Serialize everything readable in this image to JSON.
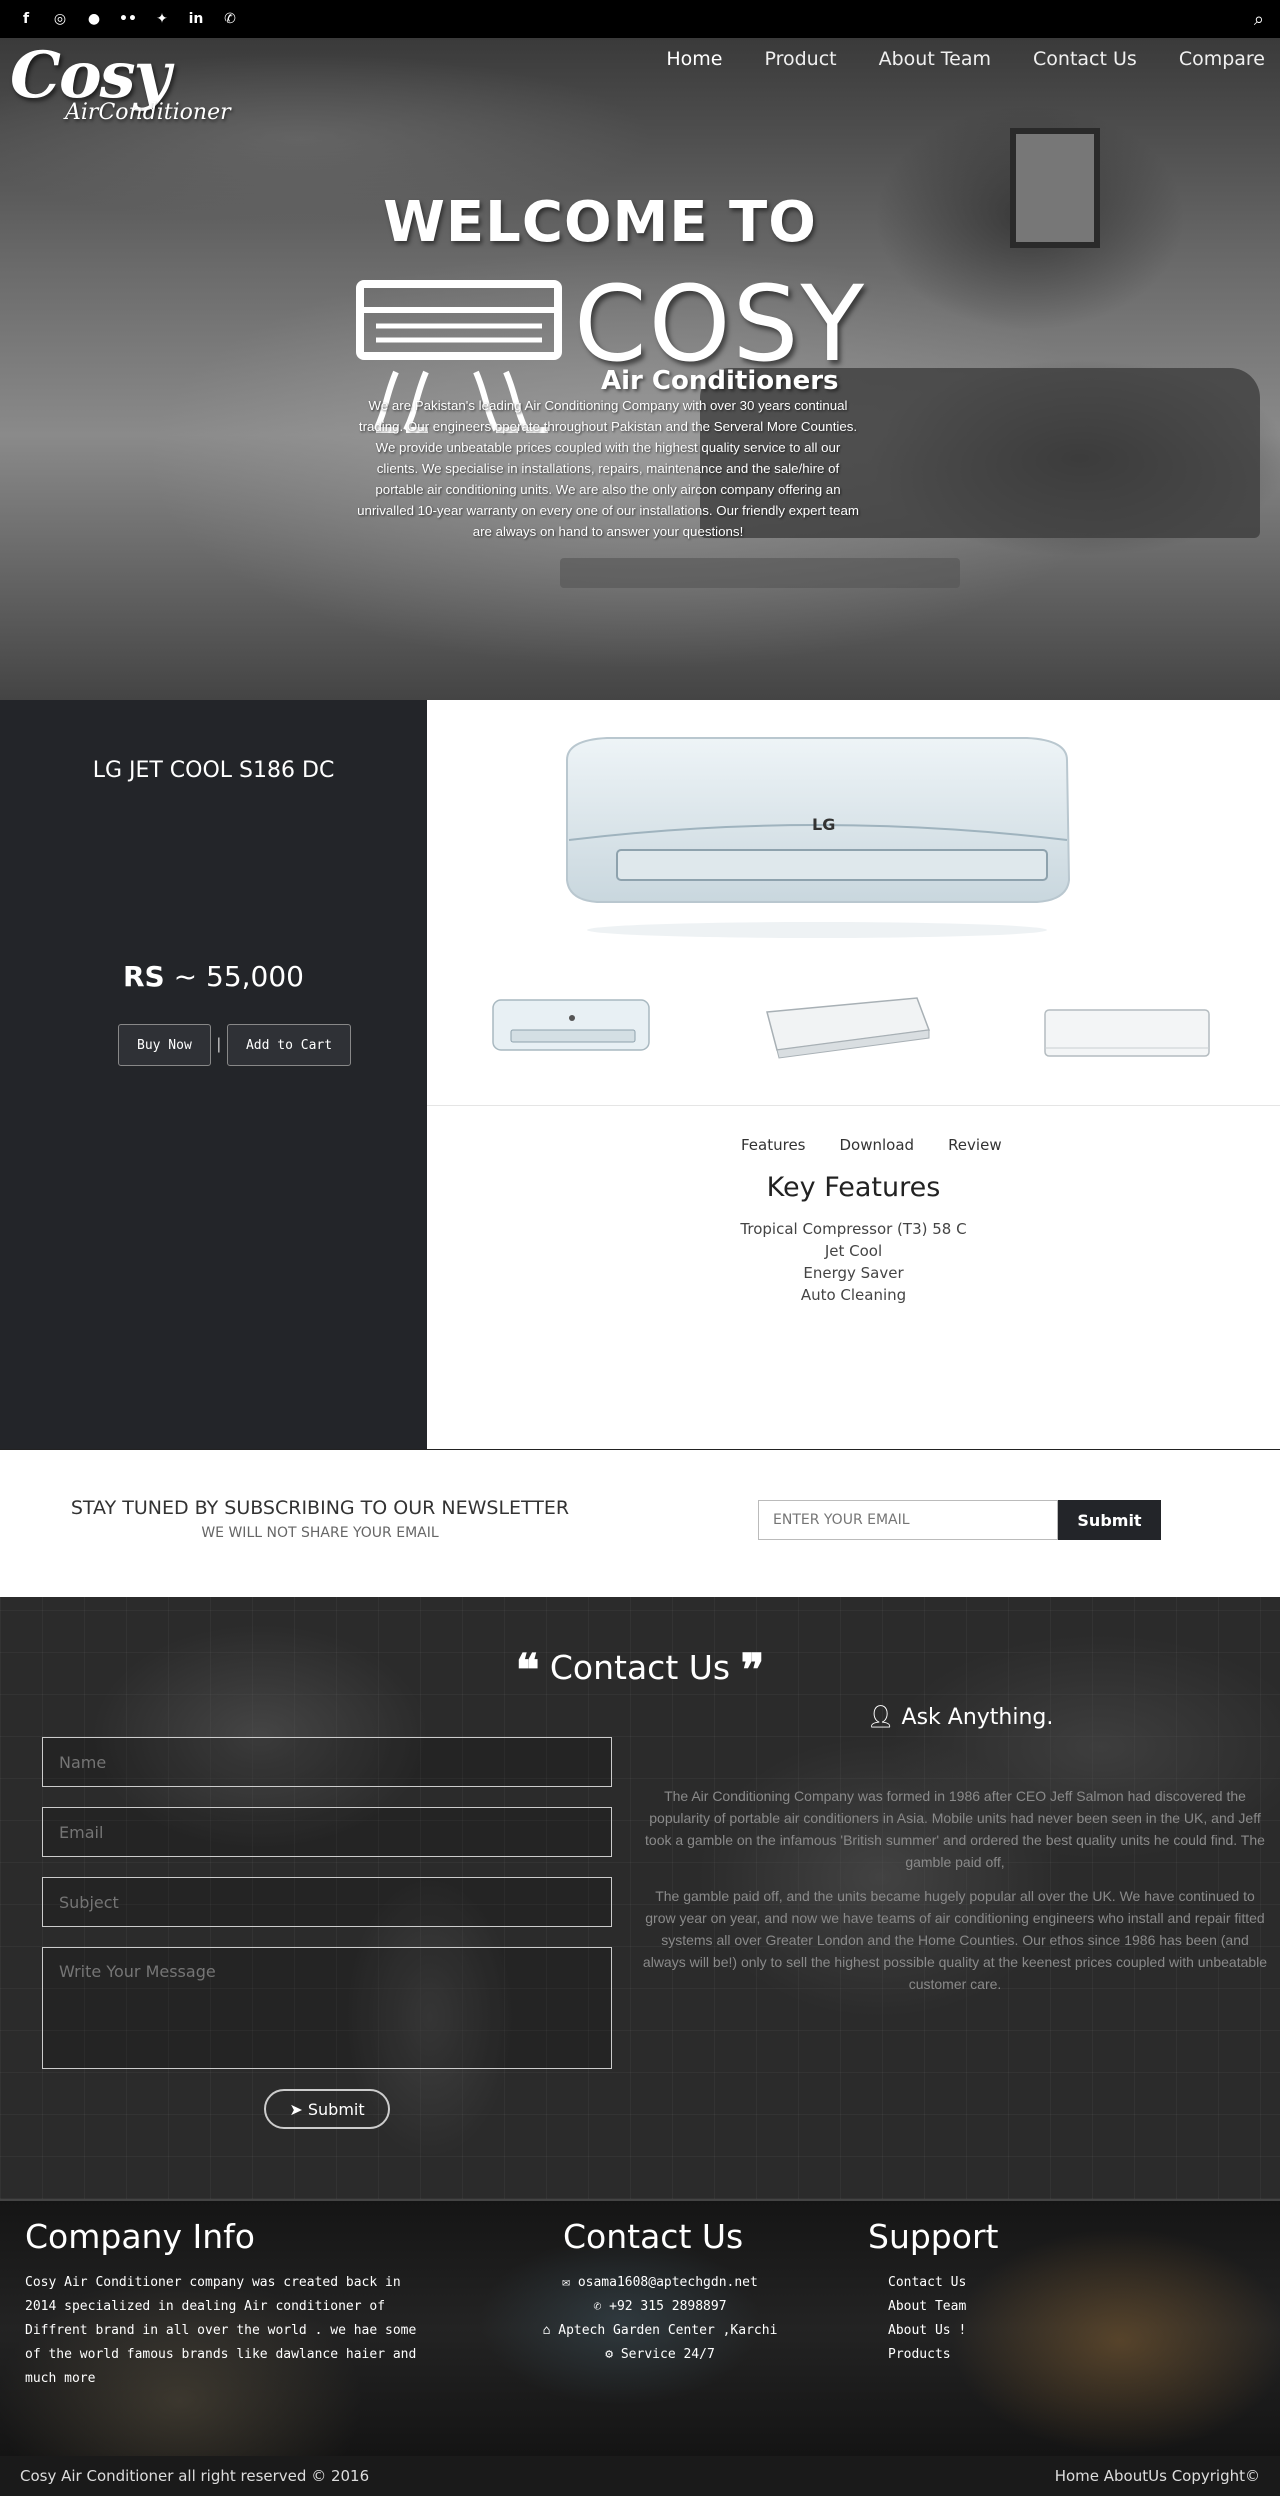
{
  "topbar": {
    "social_icons": [
      {
        "name": "facebook-icon",
        "glyph": "f"
      },
      {
        "name": "instagram-icon",
        "glyph": "◎"
      },
      {
        "name": "snapchat-icon",
        "glyph": "●"
      },
      {
        "name": "flickr-icon",
        "glyph": "••"
      },
      {
        "name": "twitter-icon",
        "glyph": "✦"
      },
      {
        "name": "linkedin-icon",
        "glyph": "in"
      },
      {
        "name": "phone-icon",
        "glyph": "✆"
      }
    ],
    "search_glyph": "⌕"
  },
  "logo": {
    "line1": "Cosy",
    "line2": "AirConditioner"
  },
  "nav": {
    "items": [
      "Home",
      "Product",
      "About Team",
      "Contact Us",
      "Compare"
    ]
  },
  "hero": {
    "welcome": "WELCOME TO",
    "brand": "COSY",
    "brand_sub": "Air Conditioners",
    "description": "We are Pakistan's leading Air Conditioning Company with over 30 years continual trading. Our engineers operate throughout Pakistan and the Serveral More Counties. We provide unbeatable prices coupled with the highest quality service to all our clients. We specialise in installations, repairs, maintenance and the sale/hire of portable air conditioning units. We are also the only aircon company offering an unrivalled 10-year warranty on every one of our installations. Our friendly expert team are always on hand to answer your questions!"
  },
  "product": {
    "title": "LG JET COOL S186 DC",
    "price_prefix": "RS",
    "price_value": "~ 55,000",
    "buy_label": "Buy Now",
    "sep": "|",
    "cart_label": "Add to Cart",
    "tabs": [
      "Features",
      "Download",
      "Review"
    ],
    "key_features_title": "Key Features",
    "features": [
      "Tropical Compressor (T3) 58 C",
      "Jet Cool",
      "Energy Saver",
      "Auto Cleaning"
    ],
    "brand_mark": "LG"
  },
  "newsletter": {
    "title": "STAY TUNED BY SUBSCRIBING TO OUR NEWSLETTER",
    "subtitle": "WE WILL NOT SHARE YOUR EMAIL",
    "placeholder": "ENTER YOUR EMAIL",
    "submit": "Submit"
  },
  "contact": {
    "title": "Contact Us",
    "quote_open": "❝",
    "quote_close": "❞",
    "name_placeholder": "Name",
    "email_placeholder": "Email",
    "subject_placeholder": "Subject",
    "message_placeholder": "Write Your Message",
    "submit": "Submit",
    "ask_title": "Ask Anything.",
    "para1": "The Air Conditioning Company was formed in 1986 after CEO Jeff Salmon had discovered the popularity of portable air conditioners in Asia. Mobile units had never been seen in the UK, and Jeff took a gamble on the infamous 'British summer' and ordered the best quality units he could find. The gamble paid off,",
    "para2": "The gamble paid off, and the units became hugely popular all over the UK. We have continued to grow year on year, and now we have teams of air conditioning engineers who install and repair fitted systems all over Greater London and the Home Counties. Our ethos since 1986 has been (and always will be!) only to sell the highest possible quality at the keenest prices coupled with unbeatable customer care."
  },
  "footer": {
    "company_title": "Company Info",
    "company_text": "Cosy Air Conditioner company was created back in 2014 specialized in dealing Air conditioner of Diffrent brand in all over the world . we hae some of the world famous brands like dawlance haier and much more",
    "contact_title": "Contact Us",
    "email": "osama1608@aptechgdn.net",
    "phone": "+92 315 2898897",
    "address": "Aptech Garden Center ,Karchi",
    "service": "Service 24/7",
    "support_title": "Support",
    "support_links": [
      "Contact Us",
      "About Team",
      "About Us !",
      "Products"
    ]
  },
  "copyright": {
    "left": "Cosy Air Conditioner all right reserved © 2016",
    "links": [
      "Home",
      "AboutUs",
      "Copyright©"
    ]
  }
}
